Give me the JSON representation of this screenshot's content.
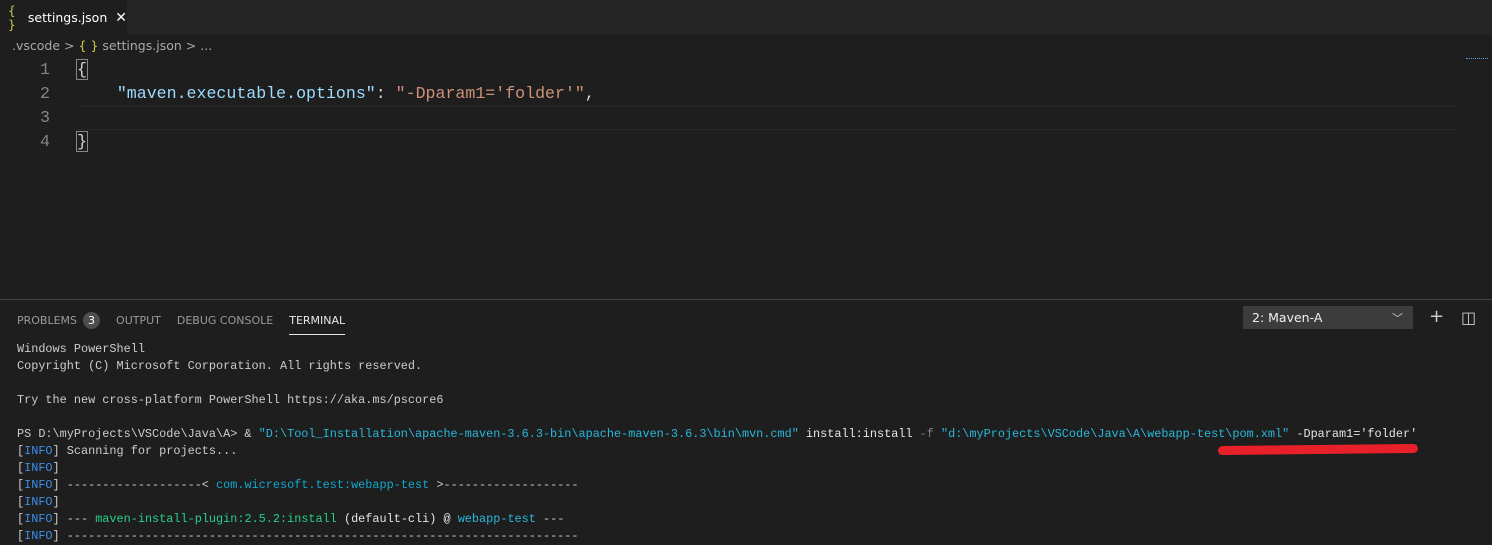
{
  "tab": {
    "icon": "{ }",
    "label": "settings.json",
    "close": "✕"
  },
  "breadcrumb": {
    "folder": ".vscode",
    "sep": ">",
    "icon": "{ }",
    "file": "settings.json",
    "more": "..."
  },
  "editor": {
    "lines": [
      {
        "n": "1",
        "segs": [
          {
            "t": "{",
            "c": "pun brace"
          }
        ]
      },
      {
        "n": "2",
        "segs": [
          {
            "t": "    ",
            "c": "pun"
          },
          {
            "t": "\"maven.executable.options\"",
            "c": "key"
          },
          {
            "t": ": ",
            "c": "pun"
          },
          {
            "t": "\"-Dparam1='folder'\"",
            "c": "str"
          },
          {
            "t": ",",
            "c": "pun"
          }
        ]
      },
      {
        "n": "3",
        "segs": []
      },
      {
        "n": "4",
        "segs": [
          {
            "t": "}",
            "c": "pun brace"
          }
        ]
      }
    ]
  },
  "panel": {
    "tabs": [
      {
        "label": "PROBLEMS",
        "badge": "3"
      },
      {
        "label": "OUTPUT"
      },
      {
        "label": "DEBUG CONSOLE"
      },
      {
        "label": "TERMINAL"
      }
    ],
    "terminal_select": "2: Maven-A",
    "add": "+",
    "split": "◫"
  },
  "terminal": {
    "lines": [
      [
        {
          "t": "Windows PowerShell",
          "c": ""
        }
      ],
      [
        {
          "t": "Copyright (C) Microsoft Corporation. All rights reserved.",
          "c": ""
        }
      ],
      [],
      [
        {
          "t": "Try the new cross-platform PowerShell https://aka.ms/pscore6",
          "c": ""
        }
      ],
      [],
      [
        {
          "t": "PS D:\\myProjects\\VSCode\\Java\\A> & ",
          "c": ""
        },
        {
          "t": "\"D:\\Tool_Installation\\apache-maven-3.6.3-bin\\apache-maven-3.6.3\\bin\\mvn.cmd\"",
          "c": "c-cyan"
        },
        {
          "t": " install:install ",
          "c": "c-white"
        },
        {
          "t": "-f",
          "c": "c-gray"
        },
        {
          "t": " ",
          "c": ""
        },
        {
          "t": "\"d:\\myProjects\\VSCode\\Java\\A\\webapp-test\\pom.xml\"",
          "c": "c-cyan"
        },
        {
          "t": " -Dparam1='folder'",
          "c": "c-white"
        }
      ],
      [
        {
          "t": "[",
          "c": ""
        },
        {
          "t": "INFO",
          "c": "c-blue"
        },
        {
          "t": "] Scanning for projects...",
          "c": ""
        }
      ],
      [
        {
          "t": "[",
          "c": ""
        },
        {
          "t": "INFO",
          "c": "c-blue"
        },
        {
          "t": "]",
          "c": ""
        }
      ],
      [
        {
          "t": "[",
          "c": ""
        },
        {
          "t": "INFO",
          "c": "c-blue"
        },
        {
          "t": "] -------------------< ",
          "c": ""
        },
        {
          "t": "com.wicresoft.test:webapp-test",
          "c": "c-teal"
        },
        {
          "t": " >-------------------",
          "c": ""
        }
      ],
      [
        {
          "t": "[",
          "c": ""
        },
        {
          "t": "INFO",
          "c": "c-blue"
        },
        {
          "t": "]",
          "c": ""
        }
      ],
      [
        {
          "t": "[",
          "c": ""
        },
        {
          "t": "INFO",
          "c": "c-blue"
        },
        {
          "t": "] --- ",
          "c": ""
        },
        {
          "t": "maven-install-plugin:2.5.2:install",
          "c": "c-green"
        },
        {
          "t": " (default-cli) @ ",
          "c": "c-white"
        },
        {
          "t": "webapp-test",
          "c": "c-cyan"
        },
        {
          "t": " ---",
          "c": ""
        }
      ],
      [
        {
          "t": "[",
          "c": ""
        },
        {
          "t": "INFO",
          "c": "c-blue"
        },
        {
          "t": "] ------------------------------------------------------------------------",
          "c": ""
        }
      ]
    ]
  }
}
